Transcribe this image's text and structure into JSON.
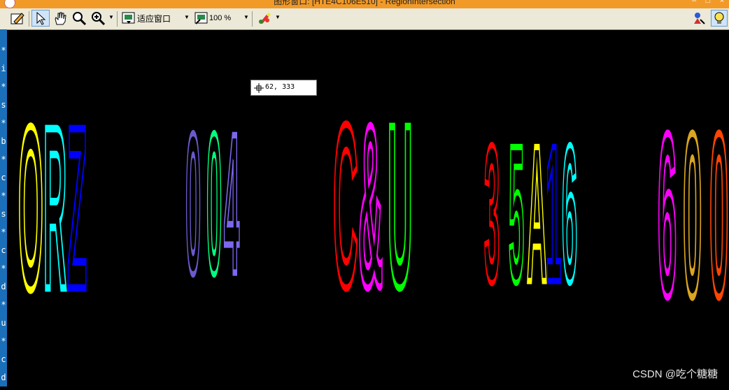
{
  "window": {
    "title": "图形窗口: [HTE4C106E510] - RegionIntersection"
  },
  "toolbar": {
    "fit_label": "适应窗口",
    "zoom_label": "100 %"
  },
  "left_strip": {
    "chars": [
      "*",
      "i",
      "*",
      "s",
      "*",
      "b",
      "*",
      "c",
      "*",
      "s",
      "*",
      "c",
      "*",
      "d",
      "*",
      "u",
      "*",
      "c",
      "d"
    ]
  },
  "cursor": {
    "coord_text": "62, 333"
  },
  "watermark": {
    "text": "CSDN @吃个糖糖"
  },
  "regions": {
    "group1": [
      "O",
      "R",
      "Z"
    ],
    "group2": [
      "0",
      "0",
      "4"
    ],
    "group3": [
      "C",
      "&",
      "U"
    ],
    "group4": [
      "3",
      "5",
      "A",
      "1",
      "6"
    ],
    "group5": [
      "6",
      "0",
      "0"
    ]
  },
  "colors": {
    "title_bar": "#f29a28",
    "toolbar_bg": "#ece9d8",
    "canvas_bg": "#000000",
    "left_strip": "#1a6fb8",
    "region_colors": [
      "#ffff00",
      "#00ffff",
      "#0000ff",
      "#6a5acd",
      "#00ff7f",
      "#7b68ee",
      "#ff0000",
      "#ff00ff",
      "#00ff00",
      "#ff0000",
      "#00ff00",
      "#ffff00",
      "#0000ff",
      "#00ffff",
      "#ff00ff",
      "#daa520",
      "#ff4500",
      "#ff7f50"
    ]
  },
  "icons": [
    "draw-icon",
    "pointer-icon",
    "hand-icon",
    "zoom-icon",
    "zoom-in-icon",
    "fit-window-icon",
    "zoom-percent-icon",
    "color-palette-icon",
    "region-tool-icon",
    "lightbulb-icon"
  ]
}
